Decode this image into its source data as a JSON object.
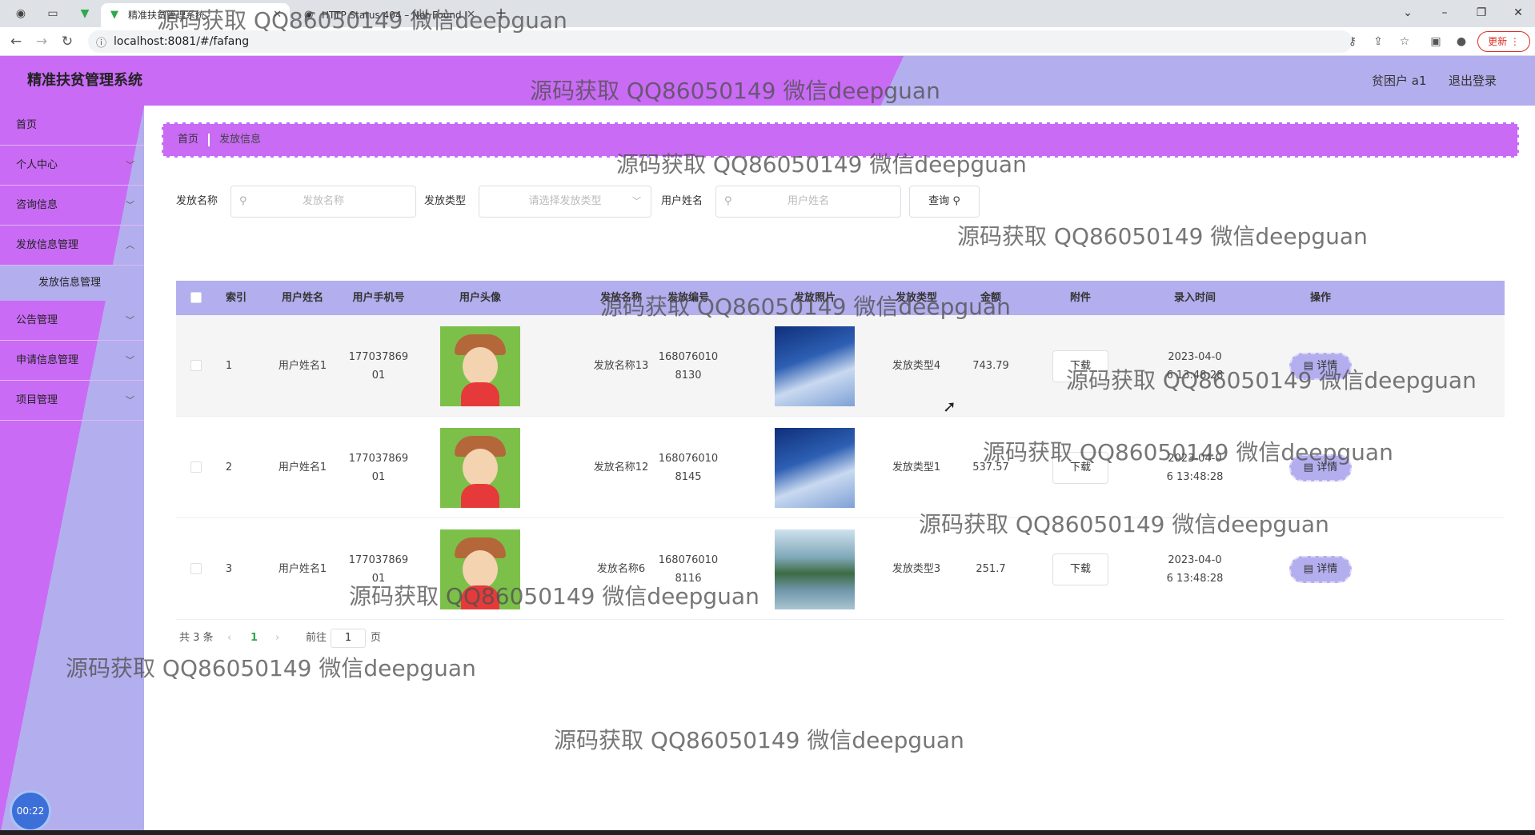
{
  "browser": {
    "tabs": [
      {
        "title": "精准扶贫管理系统",
        "active": true
      },
      {
        "title": "HTTP Status 404 – Not Found",
        "active": false
      }
    ],
    "new_tab": "+",
    "url": "localhost:8081/#/fafang",
    "update_label": "更新"
  },
  "header": {
    "title": "精准扶贫管理系统",
    "user": "贫困户 a1",
    "logout": "退出登录",
    "colors": {
      "primary": "#c96bf5",
      "secondary": "#b3aeed"
    }
  },
  "sidebar": {
    "items": [
      {
        "label": "首页",
        "has_children": false
      },
      {
        "label": "个人中心",
        "has_children": true
      },
      {
        "label": "咨询信息",
        "has_children": true
      },
      {
        "label": "发放信息管理",
        "has_children": true
      },
      {
        "label": "公告管理",
        "has_children": true
      },
      {
        "label": "申请信息管理",
        "has_children": true
      },
      {
        "label": "项目管理",
        "has_children": true
      }
    ],
    "active_submenu": "发放信息管理",
    "timer": "00:22"
  },
  "breadcrumb": {
    "home": "首页",
    "current": "发放信息"
  },
  "search": {
    "name_label": "发放名称",
    "name_placeholder": "发放名称",
    "type_label": "发放类型",
    "type_placeholder": "请选择发放类型",
    "user_label": "用户姓名",
    "user_placeholder": "用户姓名",
    "query_label": "查询"
  },
  "table": {
    "columns": [
      "索引",
      "用户姓名",
      "用户手机号",
      "用户头像",
      "发放名称",
      "发放编号",
      "发放照片",
      "发放类型",
      "金额",
      "附件",
      "录入时间",
      "操作"
    ],
    "rows": [
      {
        "index": "1",
        "user_name": "用户姓名1",
        "phone_1": "177037869",
        "phone_2": "01",
        "name": "发放名称13",
        "code_1": "168076010",
        "code_2": "8130",
        "photo": "sky",
        "type": "发放类型4",
        "amount": "743.79",
        "time_1": "2023-04-0",
        "time_2": "6 13:48:28"
      },
      {
        "index": "2",
        "user_name": "用户姓名1",
        "phone_1": "177037869",
        "phone_2": "01",
        "name": "发放名称12",
        "code_1": "168076010",
        "code_2": "8145",
        "photo": "sky",
        "type": "发放类型1",
        "amount": "537.57",
        "time_1": "2023-04-0",
        "time_2": "6 13:48:28"
      },
      {
        "index": "3",
        "user_name": "用户姓名1",
        "phone_1": "177037869",
        "phone_2": "01",
        "name": "发放名称6",
        "code_1": "168076010",
        "code_2": "8116",
        "photo": "lake",
        "type": "发放类型3",
        "amount": "251.7",
        "time_1": "2023-04-0",
        "time_2": "6 13:48:28"
      }
    ],
    "download_label": "下载",
    "detail_label": "详情"
  },
  "pagination": {
    "total": "共 3 条",
    "current_page": "1",
    "goto_label": "前往",
    "goto_value": "1",
    "page_unit": "页"
  },
  "watermark": "源码获取 QQ86050149 微信deepguan"
}
